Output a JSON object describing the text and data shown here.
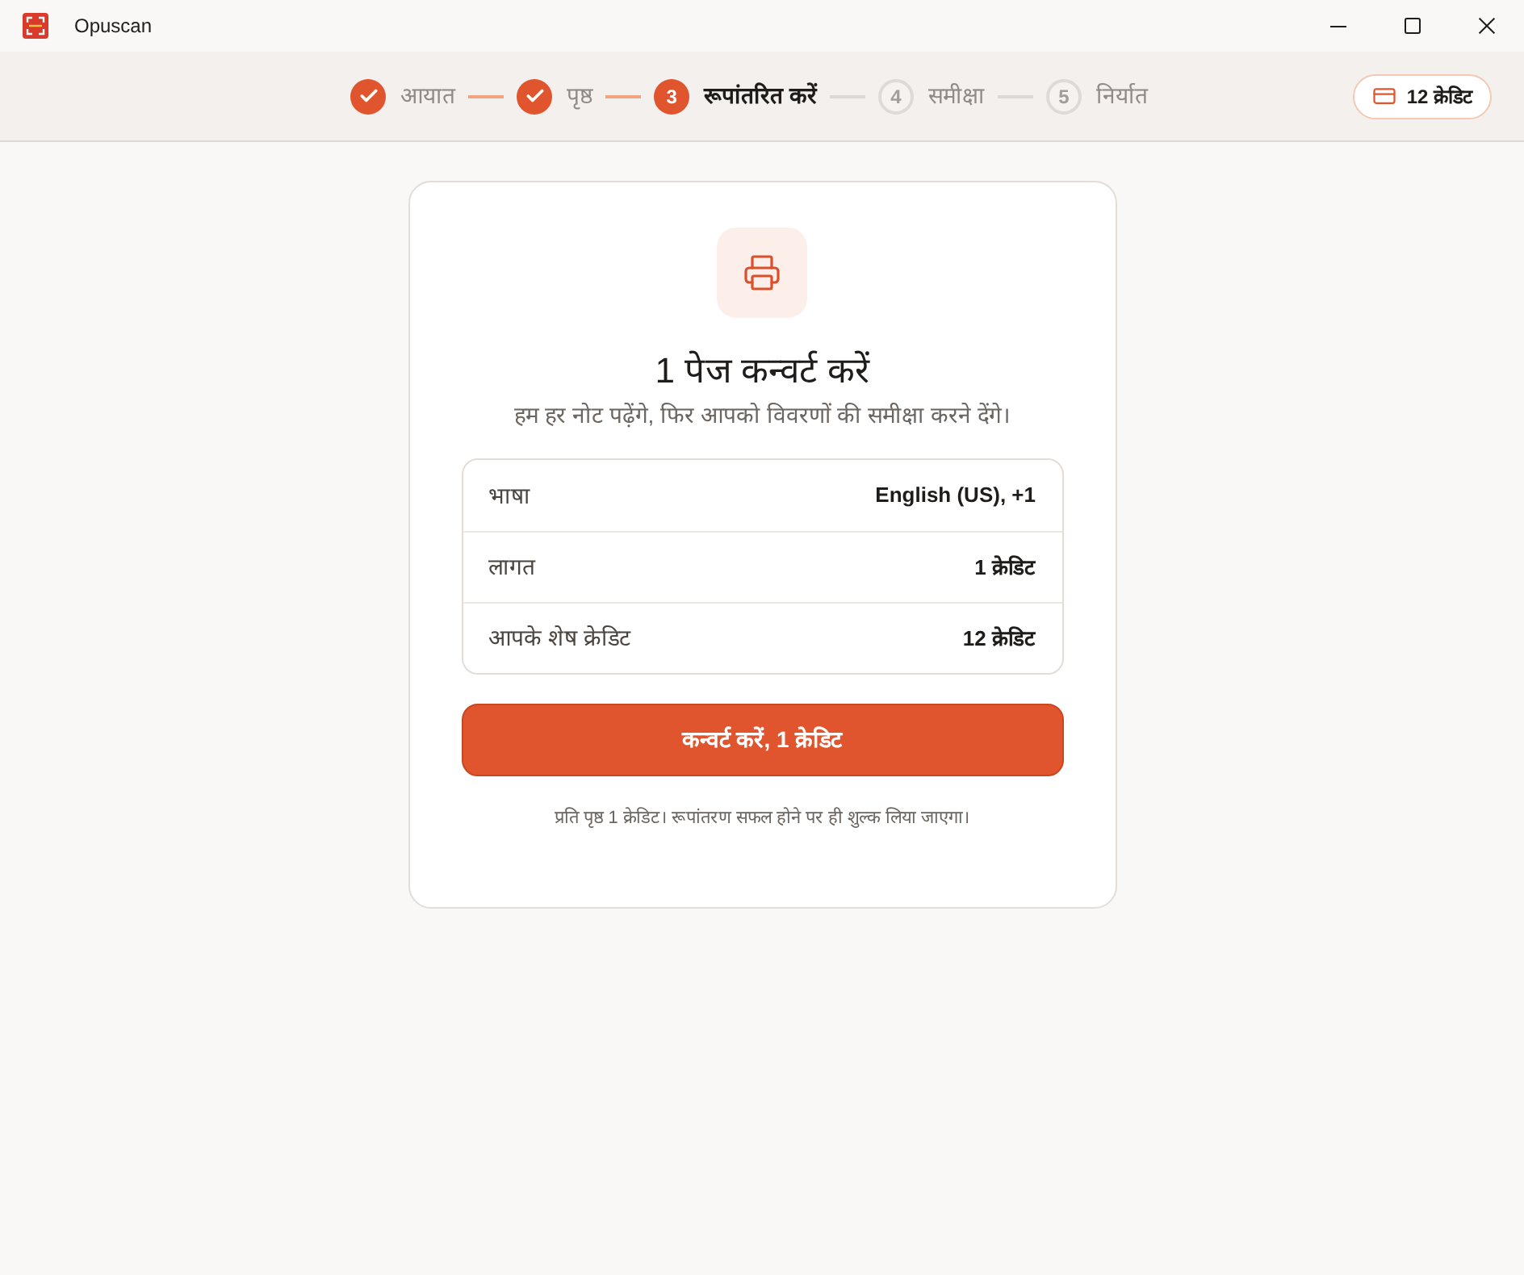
{
  "window": {
    "title": "Opuscan"
  },
  "header": {
    "steps": [
      {
        "label": "आयात",
        "done": true,
        "selected": false
      },
      {
        "label": "पृष्ठ",
        "done": true,
        "selected": false
      },
      {
        "number": "3",
        "label": "रूपांतरित करें",
        "done": false,
        "selected": true
      },
      {
        "number": "4",
        "label": "समीक्षा",
        "done": false,
        "selected": false
      },
      {
        "number": "5",
        "label": "निर्यात",
        "done": false,
        "selected": false
      }
    ],
    "credits_badge": "12 क्रेडिट"
  },
  "card": {
    "title": "1 पेज कन्वर्ट करें",
    "subtitle": "हम हर नोट पढ़ेंगे, फिर आपको विवरणों की समीक्षा करने देंगे।",
    "summary": [
      {
        "label": "भाषा",
        "value": "English (US), +1"
      },
      {
        "label": "लागत",
        "value": "1 क्रेडिट"
      },
      {
        "label": "आपके शेष क्रेडिट",
        "value": "12 क्रेडिट"
      }
    ],
    "convert_button": "कन्वर्ट करें, 1 क्रेडिट",
    "footnote": "प्रति पृष्ठ 1 क्रेडिट। रूपांतरण सफल होने पर ही शुल्क लिया जाएगा।"
  }
}
